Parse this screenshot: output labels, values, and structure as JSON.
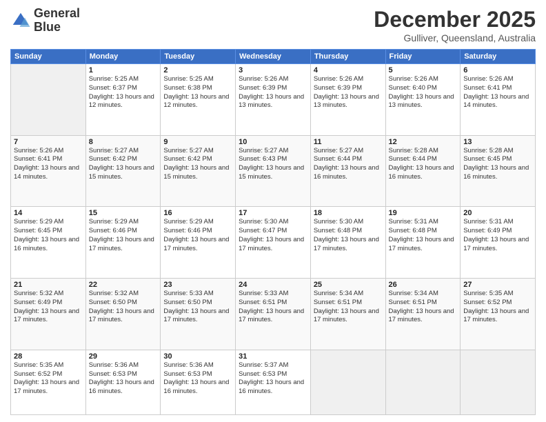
{
  "logo": {
    "line1": "General",
    "line2": "Blue"
  },
  "title": "December 2025",
  "location": "Gulliver, Queensland, Australia",
  "days_of_week": [
    "Sunday",
    "Monday",
    "Tuesday",
    "Wednesday",
    "Thursday",
    "Friday",
    "Saturday"
  ],
  "weeks": [
    [
      {
        "day": "",
        "sunrise": "",
        "sunset": "",
        "daylight": ""
      },
      {
        "day": "1",
        "sunrise": "Sunrise: 5:25 AM",
        "sunset": "Sunset: 6:37 PM",
        "daylight": "Daylight: 13 hours and 12 minutes."
      },
      {
        "day": "2",
        "sunrise": "Sunrise: 5:25 AM",
        "sunset": "Sunset: 6:38 PM",
        "daylight": "Daylight: 13 hours and 12 minutes."
      },
      {
        "day": "3",
        "sunrise": "Sunrise: 5:26 AM",
        "sunset": "Sunset: 6:39 PM",
        "daylight": "Daylight: 13 hours and 13 minutes."
      },
      {
        "day": "4",
        "sunrise": "Sunrise: 5:26 AM",
        "sunset": "Sunset: 6:39 PM",
        "daylight": "Daylight: 13 hours and 13 minutes."
      },
      {
        "day": "5",
        "sunrise": "Sunrise: 5:26 AM",
        "sunset": "Sunset: 6:40 PM",
        "daylight": "Daylight: 13 hours and 13 minutes."
      },
      {
        "day": "6",
        "sunrise": "Sunrise: 5:26 AM",
        "sunset": "Sunset: 6:41 PM",
        "daylight": "Daylight: 13 hours and 14 minutes."
      }
    ],
    [
      {
        "day": "7",
        "sunrise": "Sunrise: 5:26 AM",
        "sunset": "Sunset: 6:41 PM",
        "daylight": "Daylight: 13 hours and 14 minutes."
      },
      {
        "day": "8",
        "sunrise": "Sunrise: 5:27 AM",
        "sunset": "Sunset: 6:42 PM",
        "daylight": "Daylight: 13 hours and 15 minutes."
      },
      {
        "day": "9",
        "sunrise": "Sunrise: 5:27 AM",
        "sunset": "Sunset: 6:42 PM",
        "daylight": "Daylight: 13 hours and 15 minutes."
      },
      {
        "day": "10",
        "sunrise": "Sunrise: 5:27 AM",
        "sunset": "Sunset: 6:43 PM",
        "daylight": "Daylight: 13 hours and 15 minutes."
      },
      {
        "day": "11",
        "sunrise": "Sunrise: 5:27 AM",
        "sunset": "Sunset: 6:44 PM",
        "daylight": "Daylight: 13 hours and 16 minutes."
      },
      {
        "day": "12",
        "sunrise": "Sunrise: 5:28 AM",
        "sunset": "Sunset: 6:44 PM",
        "daylight": "Daylight: 13 hours and 16 minutes."
      },
      {
        "day": "13",
        "sunrise": "Sunrise: 5:28 AM",
        "sunset": "Sunset: 6:45 PM",
        "daylight": "Daylight: 13 hours and 16 minutes."
      }
    ],
    [
      {
        "day": "14",
        "sunrise": "Sunrise: 5:29 AM",
        "sunset": "Sunset: 6:45 PM",
        "daylight": "Daylight: 13 hours and 16 minutes."
      },
      {
        "day": "15",
        "sunrise": "Sunrise: 5:29 AM",
        "sunset": "Sunset: 6:46 PM",
        "daylight": "Daylight: 13 hours and 17 minutes."
      },
      {
        "day": "16",
        "sunrise": "Sunrise: 5:29 AM",
        "sunset": "Sunset: 6:46 PM",
        "daylight": "Daylight: 13 hours and 17 minutes."
      },
      {
        "day": "17",
        "sunrise": "Sunrise: 5:30 AM",
        "sunset": "Sunset: 6:47 PM",
        "daylight": "Daylight: 13 hours and 17 minutes."
      },
      {
        "day": "18",
        "sunrise": "Sunrise: 5:30 AM",
        "sunset": "Sunset: 6:48 PM",
        "daylight": "Daylight: 13 hours and 17 minutes."
      },
      {
        "day": "19",
        "sunrise": "Sunrise: 5:31 AM",
        "sunset": "Sunset: 6:48 PM",
        "daylight": "Daylight: 13 hours and 17 minutes."
      },
      {
        "day": "20",
        "sunrise": "Sunrise: 5:31 AM",
        "sunset": "Sunset: 6:49 PM",
        "daylight": "Daylight: 13 hours and 17 minutes."
      }
    ],
    [
      {
        "day": "21",
        "sunrise": "Sunrise: 5:32 AM",
        "sunset": "Sunset: 6:49 PM",
        "daylight": "Daylight: 13 hours and 17 minutes."
      },
      {
        "day": "22",
        "sunrise": "Sunrise: 5:32 AM",
        "sunset": "Sunset: 6:50 PM",
        "daylight": "Daylight: 13 hours and 17 minutes."
      },
      {
        "day": "23",
        "sunrise": "Sunrise: 5:33 AM",
        "sunset": "Sunset: 6:50 PM",
        "daylight": "Daylight: 13 hours and 17 minutes."
      },
      {
        "day": "24",
        "sunrise": "Sunrise: 5:33 AM",
        "sunset": "Sunset: 6:51 PM",
        "daylight": "Daylight: 13 hours and 17 minutes."
      },
      {
        "day": "25",
        "sunrise": "Sunrise: 5:34 AM",
        "sunset": "Sunset: 6:51 PM",
        "daylight": "Daylight: 13 hours and 17 minutes."
      },
      {
        "day": "26",
        "sunrise": "Sunrise: 5:34 AM",
        "sunset": "Sunset: 6:51 PM",
        "daylight": "Daylight: 13 hours and 17 minutes."
      },
      {
        "day": "27",
        "sunrise": "Sunrise: 5:35 AM",
        "sunset": "Sunset: 6:52 PM",
        "daylight": "Daylight: 13 hours and 17 minutes."
      }
    ],
    [
      {
        "day": "28",
        "sunrise": "Sunrise: 5:35 AM",
        "sunset": "Sunset: 6:52 PM",
        "daylight": "Daylight: 13 hours and 17 minutes."
      },
      {
        "day": "29",
        "sunrise": "Sunrise: 5:36 AM",
        "sunset": "Sunset: 6:53 PM",
        "daylight": "Daylight: 13 hours and 16 minutes."
      },
      {
        "day": "30",
        "sunrise": "Sunrise: 5:36 AM",
        "sunset": "Sunset: 6:53 PM",
        "daylight": "Daylight: 13 hours and 16 minutes."
      },
      {
        "day": "31",
        "sunrise": "Sunrise: 5:37 AM",
        "sunset": "Sunset: 6:53 PM",
        "daylight": "Daylight: 13 hours and 16 minutes."
      },
      {
        "day": "",
        "sunrise": "",
        "sunset": "",
        "daylight": ""
      },
      {
        "day": "",
        "sunrise": "",
        "sunset": "",
        "daylight": ""
      },
      {
        "day": "",
        "sunrise": "",
        "sunset": "",
        "daylight": ""
      }
    ]
  ]
}
